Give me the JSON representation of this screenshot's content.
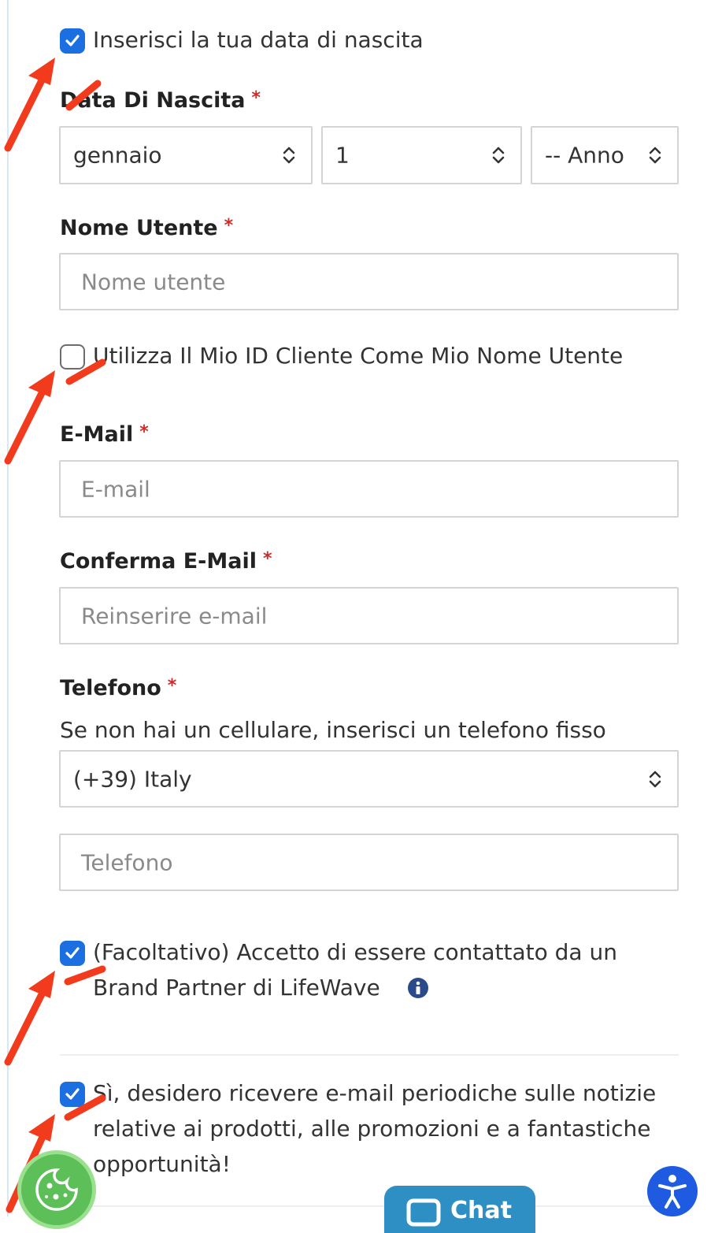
{
  "birth_checkbox": {
    "label": "Inserisci la tua data di nascita",
    "checked": true
  },
  "dob": {
    "label": "Data Di Nascita",
    "required_mark": "*",
    "month_value": "gennaio",
    "day_value": "1",
    "year_value": "-- Anno"
  },
  "username": {
    "label": "Nome Utente",
    "required_mark": "*",
    "placeholder": "Nome utente"
  },
  "use_id_checkbox": {
    "label": "Utilizza Il Mio ID Cliente Come Mio Nome Utente",
    "checked": false
  },
  "email": {
    "label": "E-Mail",
    "required_mark": "*",
    "placeholder": "E-mail"
  },
  "confirm_email": {
    "label": "Conferma E-Mail",
    "required_mark": "*",
    "placeholder": "Reinserire e-mail"
  },
  "phone": {
    "label": "Telefono",
    "required_mark": "*",
    "helper": "Se non hai un cellulare, inserisci un telefono fisso",
    "country_value": "(+39) Italy",
    "placeholder": "Telefono"
  },
  "contact_consent": {
    "line1": "(Facoltativo) Accetto di essere contattato da un",
    "line2": "Brand Partner di LifeWave",
    "checked": true
  },
  "newsletter": {
    "line1": "Sì, desidero ricevere e-mail periodiche sulle notizie",
    "line2": "relative ai prodotti, alle promozioni e a fantastiche",
    "line3": "opportunità!",
    "checked": true
  },
  "chat_button": {
    "label": "Chat"
  },
  "icons": [
    "checkmark-icon",
    "chevron-updown-icon",
    "info-icon",
    "cookie-icon",
    "accessibility-icon",
    "chat-bubble-icon",
    "red-arrow"
  ],
  "colors": {
    "accent": "#1b6fe0",
    "required": "#cc2b2b",
    "annotation_arrow": "#f23a1c",
    "cookie": "#5cbf57",
    "chat": "#2d8fc4"
  }
}
